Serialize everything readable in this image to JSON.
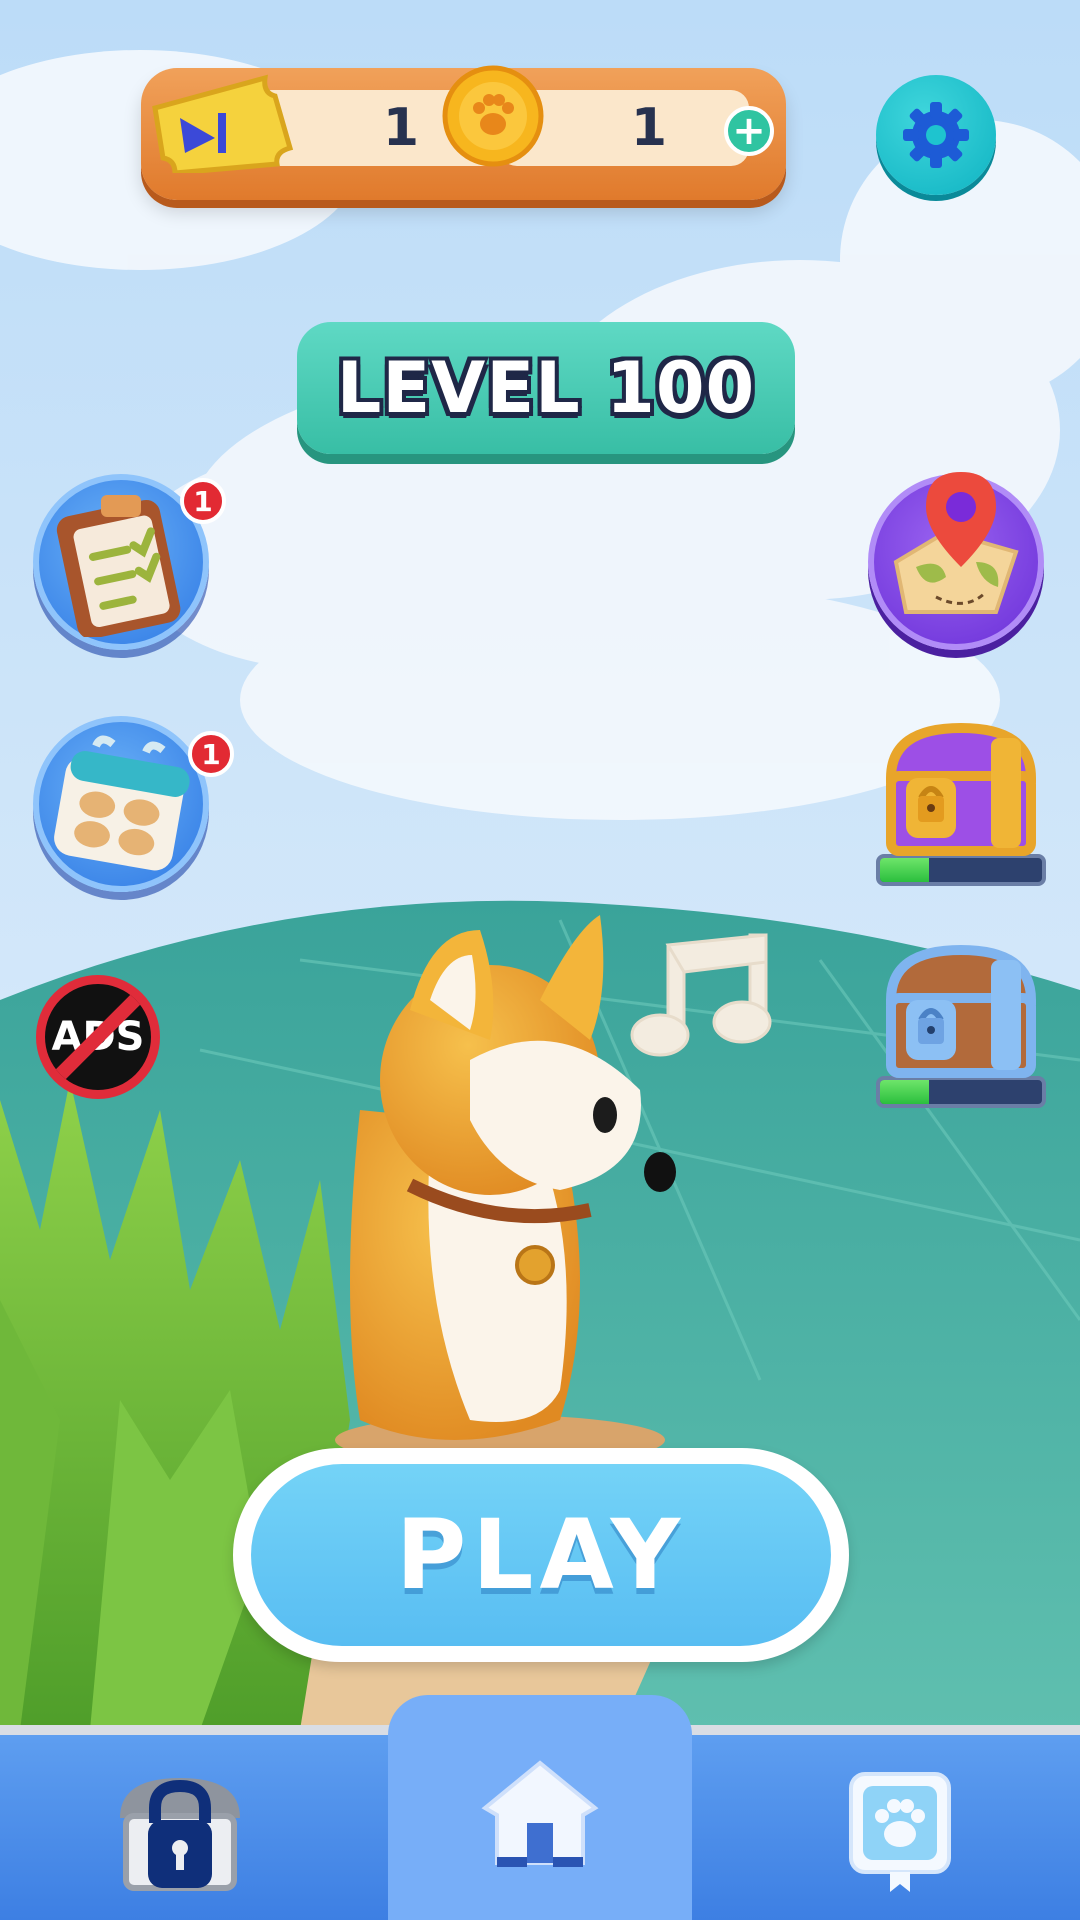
{
  "currency": {
    "tickets": "1",
    "coins": "1"
  },
  "level": {
    "label": "LEVEL 100"
  },
  "left_buttons": {
    "tasks_badge": "1",
    "calendar_badge": "1",
    "no_ads_label": "ADS"
  },
  "chests": {
    "purple_progress": 0.3,
    "blue_progress": 0.3
  },
  "play": {
    "label": "PLAY"
  },
  "bottom_nav": {
    "items": [
      {
        "icon": "locked-chest-icon"
      },
      {
        "icon": "home-icon",
        "active": true
      },
      {
        "icon": "paw-icon"
      }
    ]
  },
  "colors": {
    "accent_teal": "#38bea5",
    "play_blue": "#58bdf2",
    "nav_blue": "#3d7fe3",
    "badge_red": "#e22a33"
  }
}
